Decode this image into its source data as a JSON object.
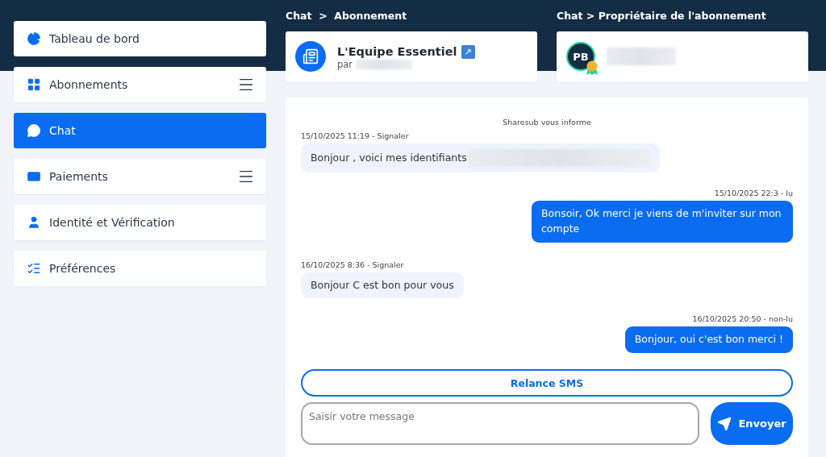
{
  "sidebar": {
    "items": [
      {
        "label": "Tableau de bord",
        "selected": false,
        "menu": false
      },
      {
        "label": "Abonnements",
        "selected": false,
        "menu": true
      },
      {
        "label": "Chat",
        "selected": true,
        "menu": false
      },
      {
        "label": "Paiements",
        "selected": false,
        "menu": true
      },
      {
        "label": "Identité et Vérification",
        "selected": false,
        "menu": false
      },
      {
        "label": "Préférences",
        "selected": false,
        "menu": false
      }
    ]
  },
  "subscription": {
    "breadcrumb": "Chat  >  Abonnement",
    "title": "L'Equipe Essentiel",
    "title_badge": "↗",
    "by_label": "par",
    "by_redacted": true
  },
  "owner": {
    "breadcrumb": "Chat > Propriétaire de l'abonnement",
    "initials": "PB",
    "award": true,
    "name_redacted": true
  },
  "chat": {
    "notice": "Sharesub vous informe",
    "messages": [
      {
        "kind": "incoming",
        "meta": "15/10/2025 11:19 - Signaler",
        "text": "Bonjour , voici mes identifiants",
        "redacted": true
      },
      {
        "kind": "outgoing",
        "meta": "15/10/2025 22:3 - lu",
        "text": "Bonsoir, Ok merci je viens de m'inviter sur mon compte",
        "redacted": false
      },
      {
        "kind": "incoming",
        "meta": "16/10/2025 8:36 - Signaler",
        "text": "Bonjour C est bon pour vous",
        "redacted": false
      },
      {
        "kind": "outgoing",
        "meta": "16/10/2025 20:50 - non-lu",
        "text": "Bonjour, oui c'est bon merci !",
        "redacted": false
      }
    ],
    "resend_button": "Relance SMS",
    "input": {
      "placeholder": "Saisir votre message"
    },
    "send_button": "Envoyer"
  }
}
